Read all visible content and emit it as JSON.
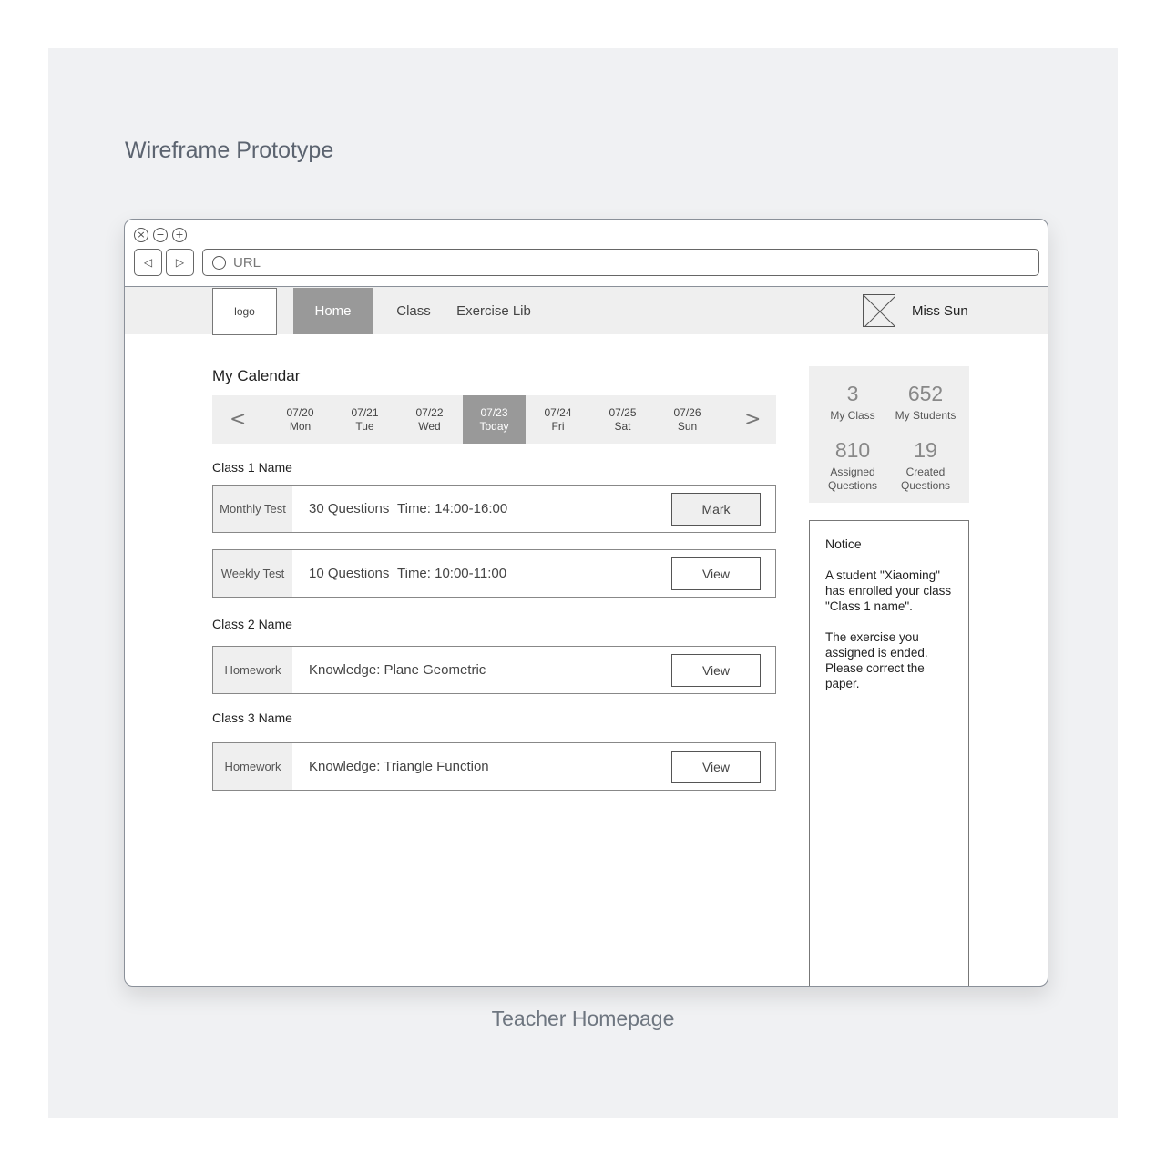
{
  "canvas": {
    "title": "Wireframe Prototype",
    "caption": "Teacher Homepage"
  },
  "browser": {
    "window_controls": [
      "×",
      "−",
      "+"
    ],
    "back_icon": "◁",
    "forward_icon": "▷",
    "url_placeholder": "URL"
  },
  "header": {
    "logo": "logo",
    "menu": {
      "home": "Home",
      "class": "Class",
      "exercise": "Exercise Lib"
    },
    "user_name": "Miss Sun"
  },
  "calendar": {
    "title": "My Calendar",
    "prev": "<",
    "next": ">",
    "days": [
      {
        "date": "07/20",
        "label": "Mon"
      },
      {
        "date": "07/21",
        "label": "Tue"
      },
      {
        "date": "07/22",
        "label": "Wed"
      },
      {
        "date": "07/23",
        "label": "Today"
      },
      {
        "date": "07/24",
        "label": "Fri"
      },
      {
        "date": "07/25",
        "label": "Sat"
      },
      {
        "date": "07/26",
        "label": "Sun"
      }
    ]
  },
  "classes": [
    {
      "name": "Class 1 Name",
      "tasks": [
        {
          "type": "Monthly Test",
          "desc": "30 Questions",
          "time": "Time: 14:00-16:00",
          "action": "Mark"
        },
        {
          "type": "Weekly Test",
          "desc": "10 Questions",
          "time": "Time: 10:00-11:00",
          "action": "View"
        }
      ]
    },
    {
      "name": "Class 2 Name",
      "tasks": [
        {
          "type": "Homework",
          "desc": "Knowledge: Plane Geometric",
          "action": "View"
        }
      ]
    },
    {
      "name": "Class 3 Name",
      "tasks": [
        {
          "type": "Homework",
          "desc": "Knowledge: Triangle Function",
          "action": "View"
        }
      ]
    }
  ],
  "stats": {
    "my_class": {
      "value": "3",
      "label": "My Class"
    },
    "my_students": {
      "value": "652",
      "label": "My Students"
    },
    "assigned": {
      "value": "810",
      "label": "Assigned Questions"
    },
    "created": {
      "value": "19",
      "label": "Created Questions"
    }
  },
  "notice": {
    "title": "Notice",
    "messages": [
      "A student \"Xiaoming\" has enrolled your class \"Class 1 name\".",
      "The exercise you assigned is ended. Please correct the paper."
    ]
  }
}
